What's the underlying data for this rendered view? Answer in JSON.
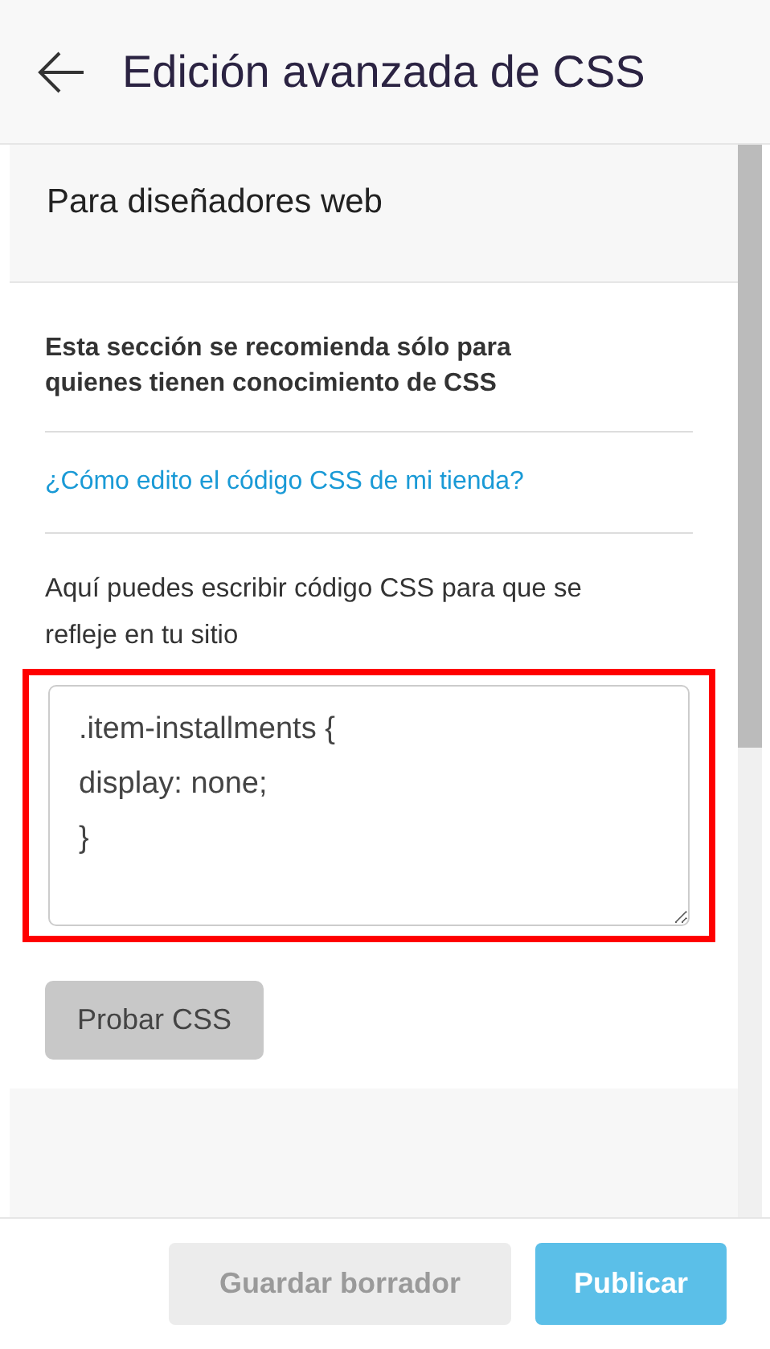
{
  "header": {
    "title": "Edición avanzada de CSS"
  },
  "section": {
    "title": "Para diseñadores web"
  },
  "warning": "Esta sección se recomienda sólo para quienes tienen conocimiento de CSS",
  "help_link": "¿Cómo edito el código CSS de mi tienda?",
  "editor": {
    "label": "Aquí puedes escribir código CSS para que se refleje en tu sitio",
    "value": ".item-installments {\ndisplay: none;\n}",
    "highlighted": true
  },
  "test_button": {
    "label": "Probar CSS"
  },
  "footer": {
    "buttons": [
      {
        "label": "Guardar borrador",
        "kind": "secondary",
        "disabled": true
      },
      {
        "label": "Publicar",
        "kind": "primary",
        "disabled": false
      }
    ]
  }
}
